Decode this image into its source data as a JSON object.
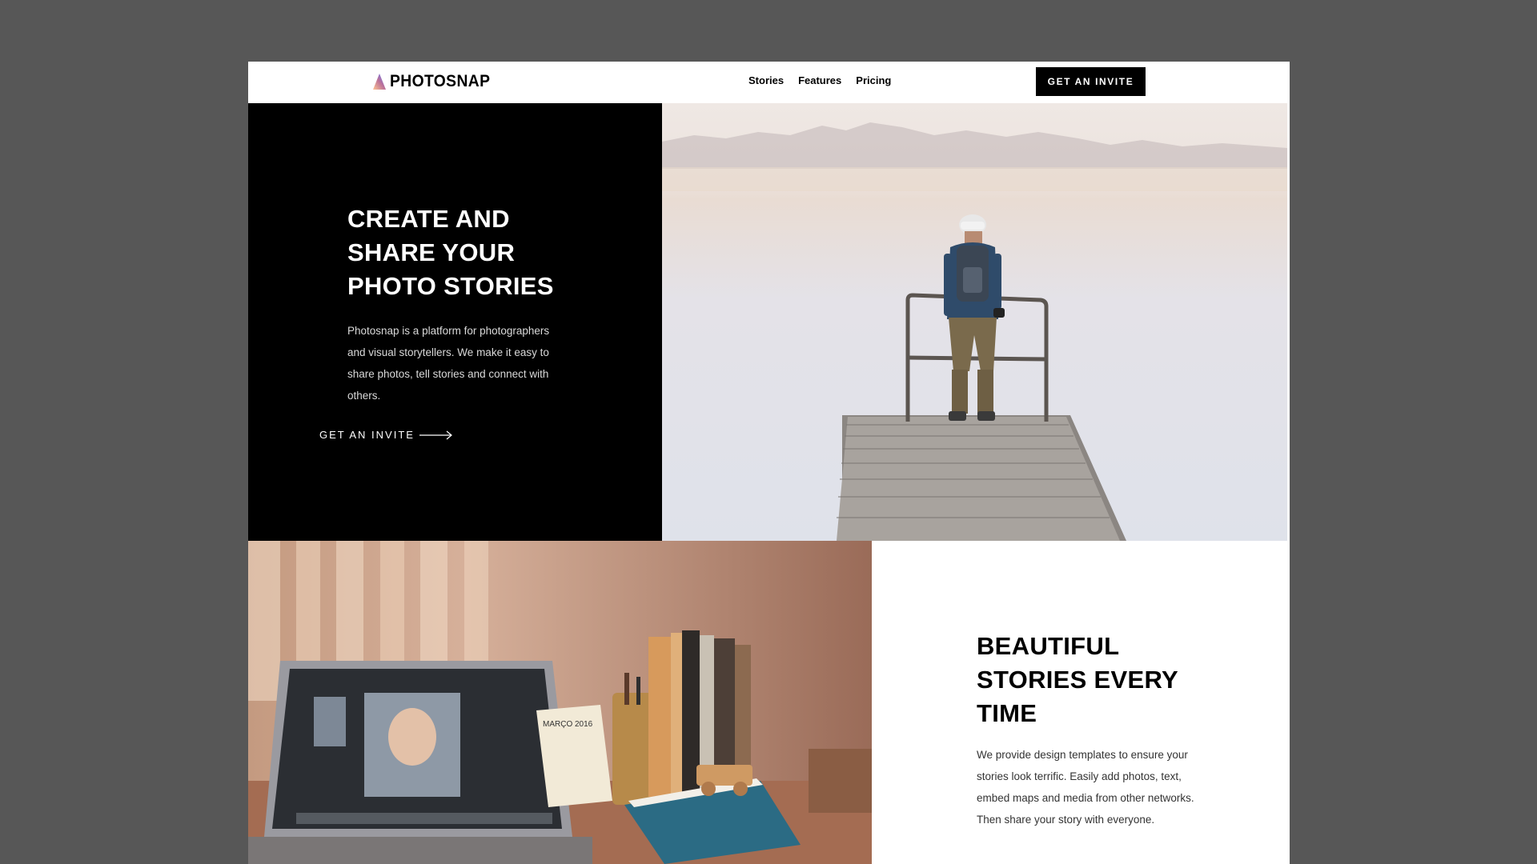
{
  "header": {
    "logo_text": "PHOTOSNAP",
    "nav": [
      "Stories",
      "Features",
      "Pricing"
    ],
    "cta_label": "GET AN INVITE"
  },
  "hero": {
    "title_lines": [
      "CREATE AND",
      "SHARE YOUR",
      "PHOTO STORIES"
    ],
    "description": "Photosnap is a platform for photographers and visual storytellers. We make it easy to share photos, tell stories and connect with others.",
    "link_label": "GET AN INVITE",
    "image_subject": "man standing on pier over lake"
  },
  "feature": {
    "title_lines": [
      "BEAUTIFUL",
      "STORIES EVERY",
      "TIME"
    ],
    "description": "We provide design templates to ensure your stories look terrific. Easily add photos, text, embed maps and media from other networks. Then share your story with everyone.",
    "image_subject": "laptop on desk with books and calendar",
    "calendar_label": "MARÇO 2016"
  },
  "colors": {
    "backdrop": "#575757",
    "primary": "#000000",
    "logo_gradient": [
      "#FFC593",
      "#BC7198",
      "#5A77FF"
    ]
  },
  "icons": [
    "logo-triangle-icon",
    "arrow-right-icon"
  ]
}
